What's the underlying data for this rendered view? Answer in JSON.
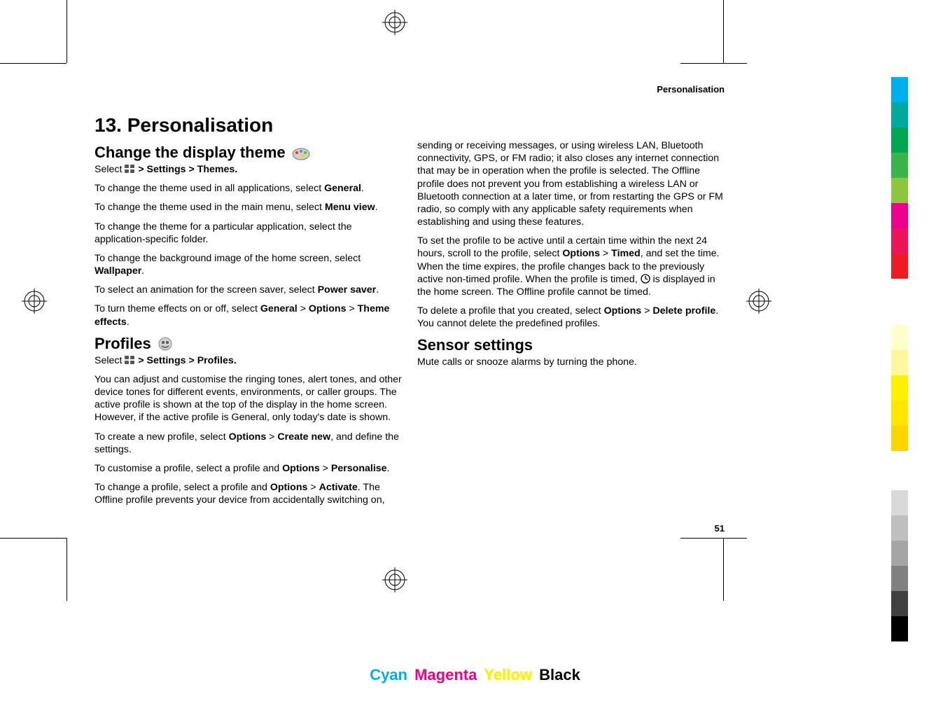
{
  "running_head": "Personalisation",
  "chapter_title": "13.  Personalisation",
  "page_number": "51",
  "sections": {
    "theme": {
      "heading": "Change the display theme",
      "select_line_pre": "Select ",
      "select_line_post": "  >  Settings  >  Themes.",
      "p_general_pre": "To change the theme used in all applications, select ",
      "p_general_b": "General",
      "p_general_post": ".",
      "p_menuview_pre": "To change the theme used in the main menu, select ",
      "p_menuview_b": "Menu view",
      "p_menuview_post": ".",
      "p_appfolder": "To change the theme for a particular application, select the application-specific folder.",
      "p_wallpaper_pre": "To change the background image of the home screen, select ",
      "p_wallpaper_b": "Wallpaper",
      "p_wallpaper_post": ".",
      "p_powersaver_pre": "To select an animation for the screen saver, select ",
      "p_powersaver_b": "Power saver",
      "p_powersaver_post": ".",
      "p_themefx_pre": "To turn theme effects on or off, select ",
      "p_themefx_b1": "General",
      "p_themefx_mid1": "  >  ",
      "p_themefx_b2": "Options",
      "p_themefx_mid2": "  >  ",
      "p_themefx_b3": "Theme effects",
      "p_themefx_post": "."
    },
    "profiles": {
      "heading": "Profiles",
      "select_line_pre": "Select ",
      "select_line_post": "  >  Settings  >  Profiles.",
      "p_intro": "You can adjust and customise the ringing tones, alert tones, and other device tones for different events, environments, or caller groups. The active profile is shown at the top of the display in the home screen. However, if the active profile is General, only today's date is shown.",
      "p_create_pre": "To create a new profile, select ",
      "p_create_b1": "Options",
      "p_create_mid1": "  >  ",
      "p_create_b2": " Create new",
      "p_create_post": ", and define the settings.",
      "p_custom_pre": "To customise a profile, select a profile and ",
      "p_custom_b1": "Options",
      "p_custom_mid1": "  >  ",
      "p_custom_b2": "Personalise",
      "p_custom_post": ".",
      "p_activate_pre": "To change a profile, select a profile and ",
      "p_activate_b1": "Options",
      "p_activate_mid1": "  >  ",
      "p_activate_b2": "Activate",
      "p_activate_post": ". The Offline profile prevents your device from accidentally switching on, sending or receiving messages, or using wireless LAN, Bluetooth connectivity, GPS, or FM radio; it also closes any internet connection that may be in operation when the profile is selected. The Offline profile does not prevent you from establishing a wireless LAN or Bluetooth connection at a later time, or from restarting the GPS or FM radio, so comply with any applicable safety requirements when establishing and using these features.",
      "p_timed_pre": "To set the profile to be active until a certain time within the next 24 hours, scroll to the profile, select ",
      "p_timed_b1": "Options",
      "p_timed_mid1": "  >  ",
      "p_timed_b2": "Timed",
      "p_timed_post1": ", and set the time. When the time expires, the profile changes back to the previously active non-timed profile. When the profile is timed, ",
      "p_timed_post2": " is displayed in the home screen. The Offline profile cannot be timed.",
      "p_delete_pre": "To delete a profile that you created, select ",
      "p_delete_b1": "Options",
      "p_delete_mid1": "  >  ",
      "p_delete_b2": " Delete profile",
      "p_delete_post": ". You cannot delete the predefined profiles."
    },
    "sensor": {
      "heading": "Sensor settings",
      "p1": "Mute calls or snooze alarms by turning the phone."
    }
  },
  "footer": {
    "cyan": "Cyan",
    "magenta": "Magenta",
    "yellow": "Yellow",
    "black": "Black"
  },
  "swatches_top": [
    "#00aeef",
    "#00a99d",
    "#00a651",
    "#39b54a",
    "#8dc63f",
    "#ec008c",
    "#ed145b",
    "#ed1c24"
  ],
  "swatches_mid": [
    "#ffffcc",
    "#fff799",
    "#fff200",
    "#ffe600",
    "#ffd400"
  ],
  "swatches_bot": [
    "#d9d9d9",
    "#bfbfbf",
    "#a6a6a6",
    "#808080",
    "#404040",
    "#000000"
  ]
}
